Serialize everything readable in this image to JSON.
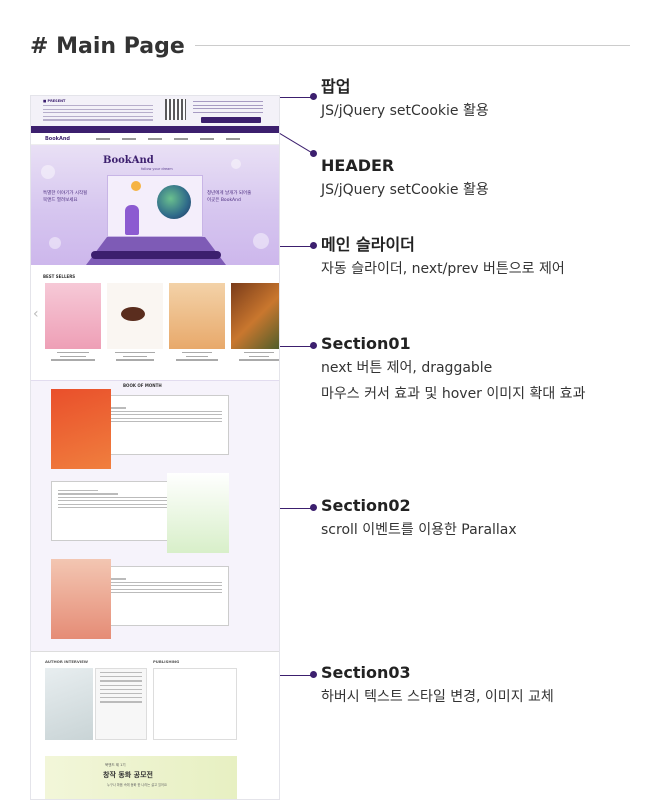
{
  "page": {
    "title": "# Main Page"
  },
  "mock": {
    "popup": {
      "logo": "■ PRESENT"
    },
    "nav": {
      "brand": "BookAnd"
    },
    "hero": {
      "logo": "BookAnd",
      "tagline": "follow your dream",
      "left_text": [
        "특별한 이야기가 시작될",
        "북앤드 열려보세요"
      ],
      "right_text": [
        "청년에게 날개가 되어줄",
        "이곳은 BookAnd"
      ]
    },
    "sec1_label": "BEST SELLERS",
    "sec2_label": "BOOK OF MONTH",
    "sec3": {
      "interview_label": "AUTHOR INTERVIEW",
      "publishing_label": "PUBLISHING",
      "banner_small": "북앤드 제 1기",
      "banner_title": "창작 동화 공모전",
      "banner_sub": "누구나 마음 속에 동화 한 나라는 살고 있어요"
    }
  },
  "annotations": [
    {
      "heading": "팝업",
      "lines": [
        "JS/jQuery setCookie 활용"
      ]
    },
    {
      "heading": "HEADER",
      "lines": [
        "JS/jQuery setCookie 활용"
      ]
    },
    {
      "heading": "메인 슬라이더",
      "lines": [
        "자동 슬라이더, next/prev 버튼으로 제어"
      ]
    },
    {
      "heading": "Section01",
      "lines": [
        "next 버튼 제어, draggable",
        "마우스 커서 효과 및 hover 이미지 확대 효과"
      ]
    },
    {
      "heading": "Section02",
      "lines": [
        "scroll 이벤트를 이용한 Parallax"
      ]
    },
    {
      "heading": "Section03",
      "lines": [
        "하버시 텍스트 스타일 변경, 이미지 교체"
      ]
    }
  ],
  "colors": {
    "accent": "#3c1f6e",
    "hero_bg": "#d6c6ef",
    "section_bg": "#f6f3fb"
  }
}
